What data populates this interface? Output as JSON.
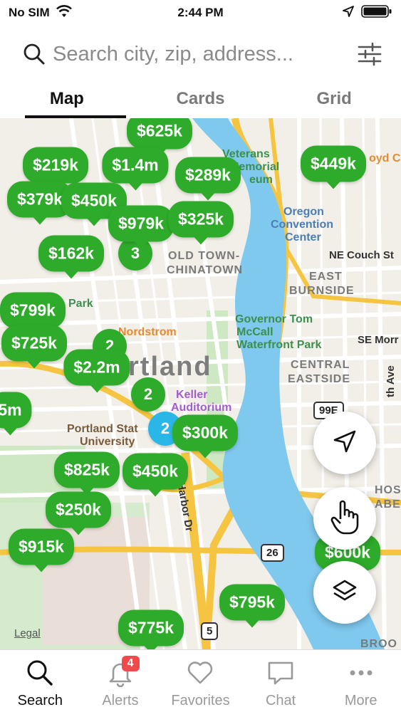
{
  "status": {
    "carrier": "No SIM",
    "time": "2:44 PM"
  },
  "search": {
    "placeholder": "Search city, zip, address..."
  },
  "tabs": [
    {
      "label": "Map",
      "active": true
    },
    {
      "label": "Cards",
      "active": false
    },
    {
      "label": "Grid",
      "active": false
    }
  ],
  "map": {
    "labels": {
      "veterans": "Veterans",
      "memorial": "Memorial",
      "coliseum": "eum",
      "oregon": "Oregon",
      "convention": "Convention",
      "center": "Center",
      "couch": "NE Couch St",
      "old_town": "OLD TOWN-",
      "chinatown": "CHINATOWN",
      "east": "EAST",
      "burnside": "BURNSIDE",
      "park": "Park",
      "nordstrom": "Nordstrom",
      "governor": "Governor Tom",
      "mccall": "McCall",
      "waterfront": "Waterfront Park",
      "se_morr": "SE Morr",
      "central": "CENTRAL",
      "eastside": "EASTSIDE",
      "portland": "rtland",
      "keller": "Keller",
      "auditorium": "Auditorium",
      "portland_state": "Portland Stat",
      "university": "University",
      "harbor": "Harbor Dr",
      "ave": "th Ave",
      "hos": "HOS",
      "aber": "ABER",
      "brook": "BROO",
      "lloyd": "oyd Ce"
    },
    "routes": {
      "r99e": "99E",
      "r26": "26",
      "r5": "5"
    },
    "legal": "Legal",
    "pins": [
      {
        "label": "$625k"
      },
      {
        "label": "$219k"
      },
      {
        "label": "$1.4m"
      },
      {
        "label": "$289k"
      },
      {
        "label": "$449k"
      },
      {
        "label": "$379k"
      },
      {
        "label": "$450k"
      },
      {
        "label": "$979k"
      },
      {
        "label": "$325k"
      },
      {
        "label": "$162k"
      },
      {
        "label": "$799k"
      },
      {
        "label": "$725k"
      },
      {
        "label": "$2.2m"
      },
      {
        "label": "$300k"
      },
      {
        "label": "$825k"
      },
      {
        "label": "$450k"
      },
      {
        "label": "$250k"
      },
      {
        "label": "$915k"
      },
      {
        "label": "$795k"
      },
      {
        "label": "$775k"
      },
      {
        "label": "$600k"
      },
      {
        "label": "5m"
      }
    ],
    "clusters": [
      {
        "label": "2"
      },
      {
        "label": "2"
      },
      {
        "label": "3"
      },
      {
        "label": "2"
      }
    ]
  },
  "nav": [
    {
      "label": "Search",
      "active": true
    },
    {
      "label": "Alerts",
      "badge": "4"
    },
    {
      "label": "Favorites"
    },
    {
      "label": "Chat"
    },
    {
      "label": "More"
    }
  ]
}
